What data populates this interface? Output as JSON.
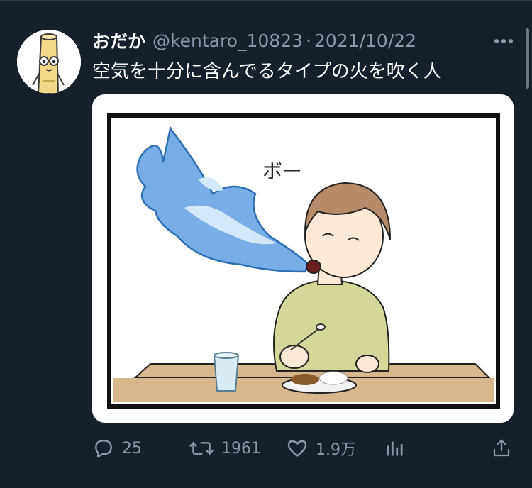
{
  "tweet": {
    "author": {
      "display_name": "おだか",
      "handle": "@kentaro_10823"
    },
    "separator": "·",
    "date": "2021/10/22",
    "text": "空気を十分に含んでるタイプの火を吹く人",
    "media": {
      "sound_text": "ボー"
    }
  },
  "actions": {
    "replies": "25",
    "retweets": "1961",
    "likes": "1.9万"
  },
  "icons": {
    "avatar": "avatar-character-icon",
    "more": "more-icon",
    "reply": "reply-icon",
    "retweet": "retweet-icon",
    "like": "heart-icon",
    "analytics": "analytics-icon",
    "share": "share-icon"
  },
  "colors": {
    "background": "#15202b",
    "secondary_text": "#8b98a5",
    "flame_blue": "#78aee8"
  }
}
